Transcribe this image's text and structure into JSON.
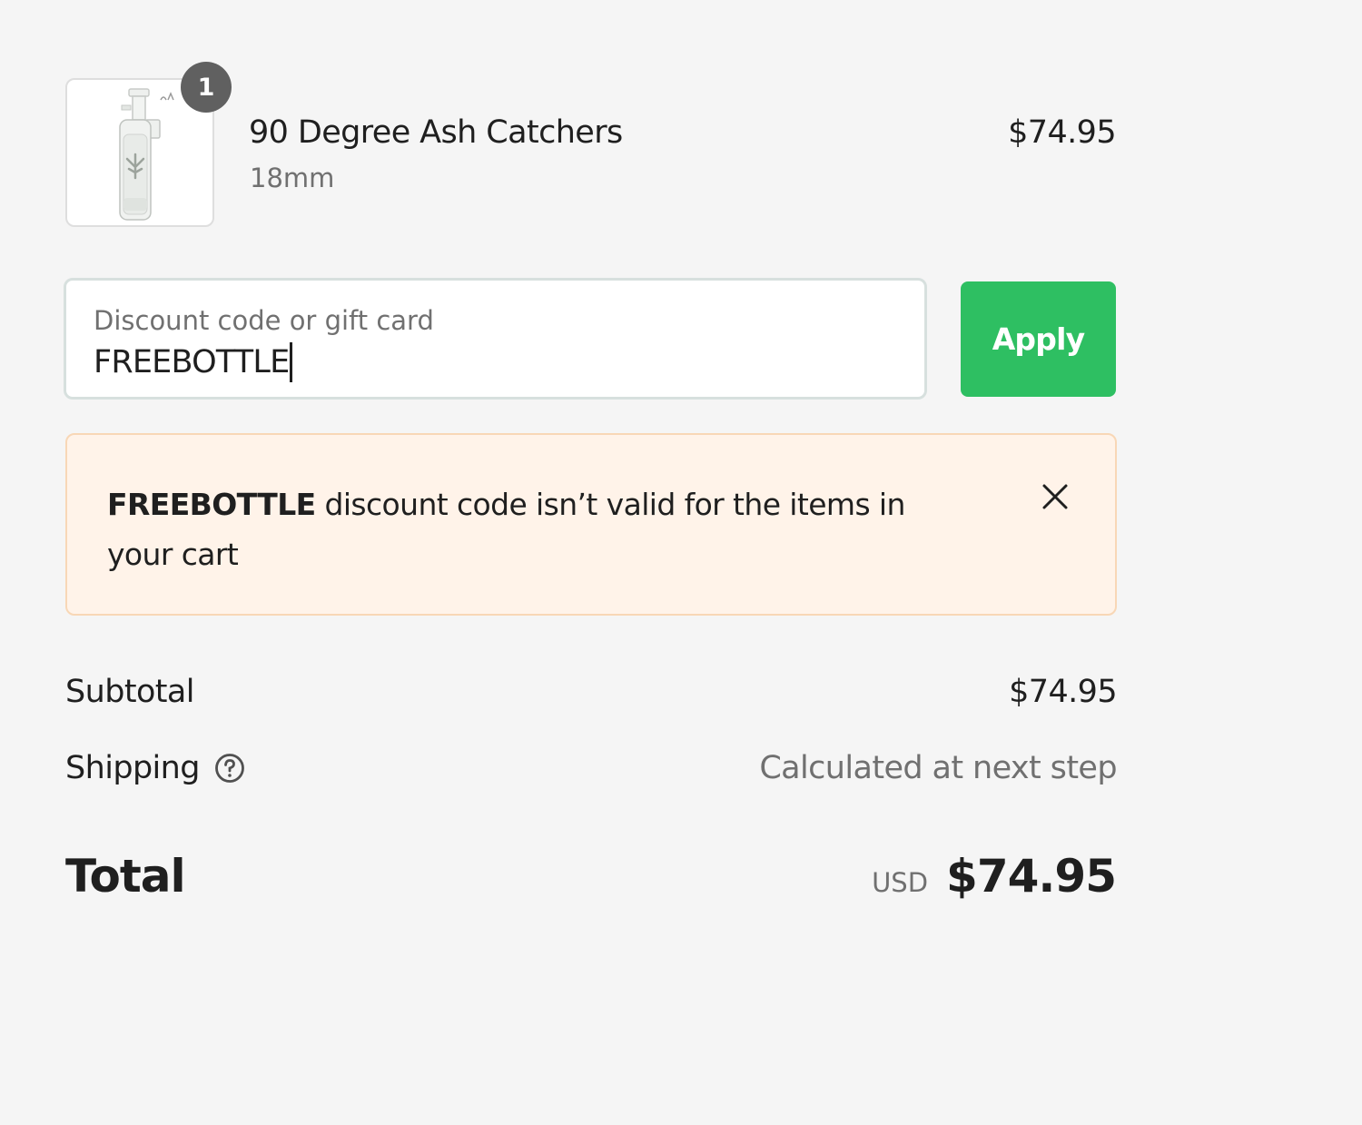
{
  "product": {
    "image_icon": "ash-catcher-product-image",
    "quantity": "1",
    "name": "90 Degree Ash Catchers",
    "variant": "18mm",
    "price": "$74.95"
  },
  "discount": {
    "label": "Discount code or gift card",
    "value": "FREEBOTTLE",
    "apply_label": "Apply",
    "apply_color": "#2ebf62"
  },
  "error": {
    "code": "FREEBOTTLE",
    "message": " discount code isn’t valid for the items in your cart",
    "close_icon": "close-icon",
    "background_color": "#fff3e9"
  },
  "summary": {
    "subtotal_label": "Subtotal",
    "subtotal_value": "$74.95",
    "shipping_label": "Shipping",
    "shipping_help_icon": "help-circle-icon",
    "shipping_value": "Calculated at next step",
    "total_label": "Total",
    "total_currency": "USD",
    "total_value": "$74.95"
  }
}
